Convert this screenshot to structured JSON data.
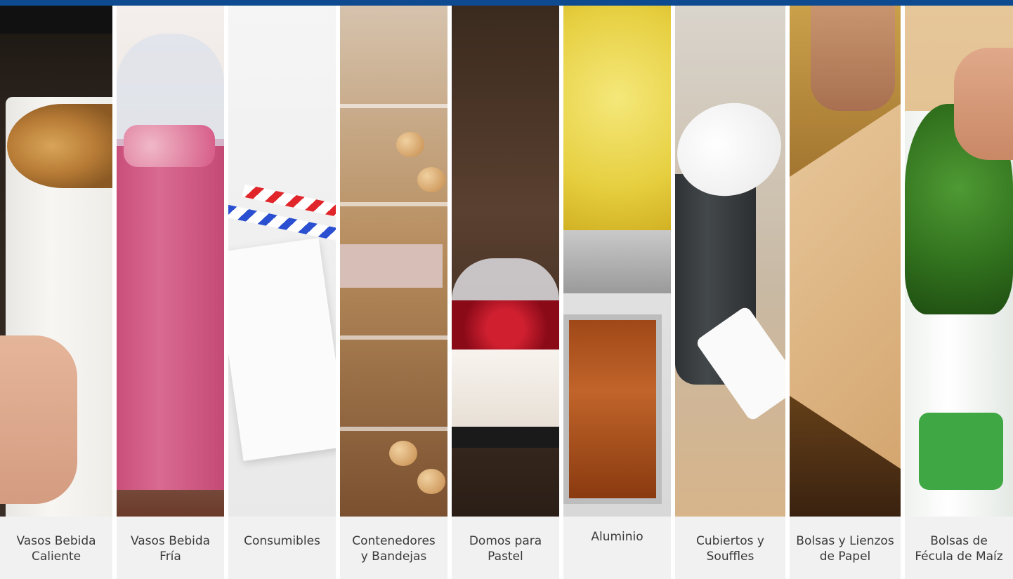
{
  "categories": [
    {
      "label": "Vasos Bebida\nCaliente"
    },
    {
      "label": "Vasos Bebida\nFría"
    },
    {
      "label": "Consumibles"
    },
    {
      "label": "Contenedores\ny Bandejas"
    },
    {
      "label": "Domos para\nPastel"
    },
    {
      "label": "Aluminio"
    },
    {
      "label": "Cubiertos y\nSouffles"
    },
    {
      "label": "Bolsas y Lienzos\nde Papel"
    },
    {
      "label": "Bolsas de\nFécula de Maíz"
    }
  ],
  "colors": {
    "top_bar": "#0e4a8f",
    "caption_bg": "#f1f1f2",
    "caption_text": "#3a3a3a"
  }
}
